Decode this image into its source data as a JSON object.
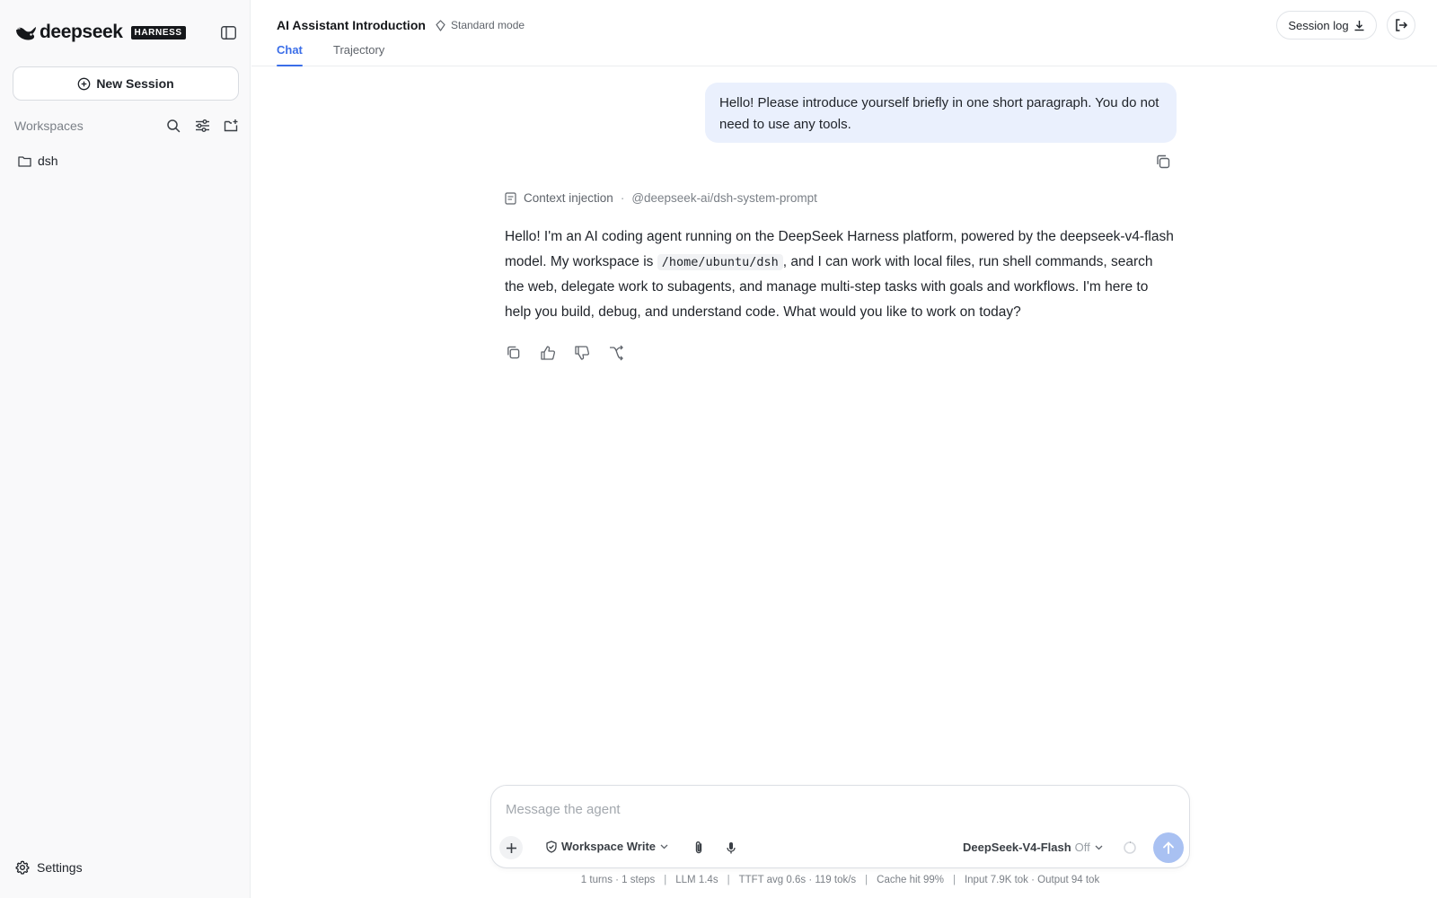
{
  "brand": {
    "name": "deepseek",
    "badge": "HARNESS",
    "accent": "#3b6ee8"
  },
  "sidebar": {
    "new_session_label": "New Session",
    "workspaces_title": "Workspaces",
    "workspaces": [
      {
        "label": "dsh",
        "icon": "folder-icon"
      }
    ],
    "settings_label": "Settings"
  },
  "header": {
    "title": "AI Assistant Introduction",
    "mode": "Standard mode",
    "tabs": [
      {
        "label": "Chat",
        "active": true
      },
      {
        "label": "Trajectory",
        "active": false
      }
    ],
    "session_log_label": "Session log"
  },
  "chat": {
    "user_message": "Hello! Please introduce yourself briefly in one short paragraph. You do not need to use any tools.",
    "context_label": "Context injection",
    "context_source": "@deepseek-ai/dsh-system-prompt",
    "assistant_part1": "Hello! I'm an AI coding agent running on the DeepSeek Harness platform, powered by the deepseek-v4-flash model. My workspace is ",
    "assistant_code": "/home/ubuntu/dsh",
    "assistant_part2": ", and I can work with local files, run shell commands, search the web, delegate work to subagents, and manage multi-step tasks with goals and workflows. I'm here to help you build, debug, and understand code. What would you like to work on today?"
  },
  "composer": {
    "placeholder": "Message the agent",
    "permission_label": "Workspace Write",
    "model_name": "DeepSeek-V4-Flash",
    "thinking_state": "Off"
  },
  "stats": {
    "turns": "1 turns · 1 steps",
    "llm": "LLM 1.4s",
    "ttft": "TTFT avg 0.6s · 119 tok/s",
    "cache": "Cache hit 99%",
    "tokens": "Input 7.9K tok · Output 94 tok"
  }
}
